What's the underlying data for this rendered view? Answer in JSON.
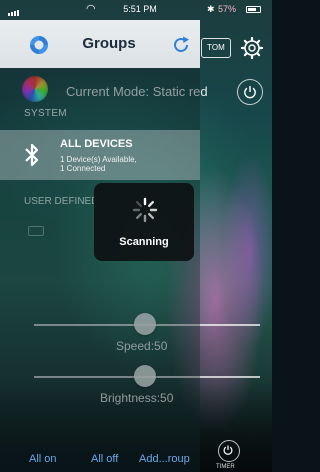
{
  "status_bar": {
    "time": "5:51 PM",
    "battery": "57%"
  },
  "header": {
    "title": "Groups"
  },
  "background_controls": {
    "custom_label": "TOM",
    "timer_label": "TIMER"
  },
  "current_mode": {
    "text": "Current Mode: Static red"
  },
  "sections": {
    "system": "SYSTEM",
    "user_defined": "USER DEFINED"
  },
  "all_devices": {
    "title": "ALL DEVICES",
    "available": "1 Device(s) Available,",
    "connected": "1 Connected"
  },
  "scanning": {
    "label": "Scanning"
  },
  "speed": {
    "label": "Speed:50",
    "value": 50
  },
  "brightness": {
    "label": "Brightness:50",
    "value": 50
  },
  "bottom_bar": {
    "all_on": "All on",
    "all_off": "All off",
    "add_group": "Add...roup"
  },
  "colors": {
    "accent_blue": "#2f7fd6",
    "link_blue": "#6aa9e8",
    "header_bg": "#eef1f4"
  },
  "icons": {
    "logo": "app-logo-icon",
    "refresh": "refresh-icon",
    "bluetooth": "bluetooth-icon",
    "settings": "gear-icon",
    "power": "power-icon",
    "spinner": "spinner-icon"
  }
}
